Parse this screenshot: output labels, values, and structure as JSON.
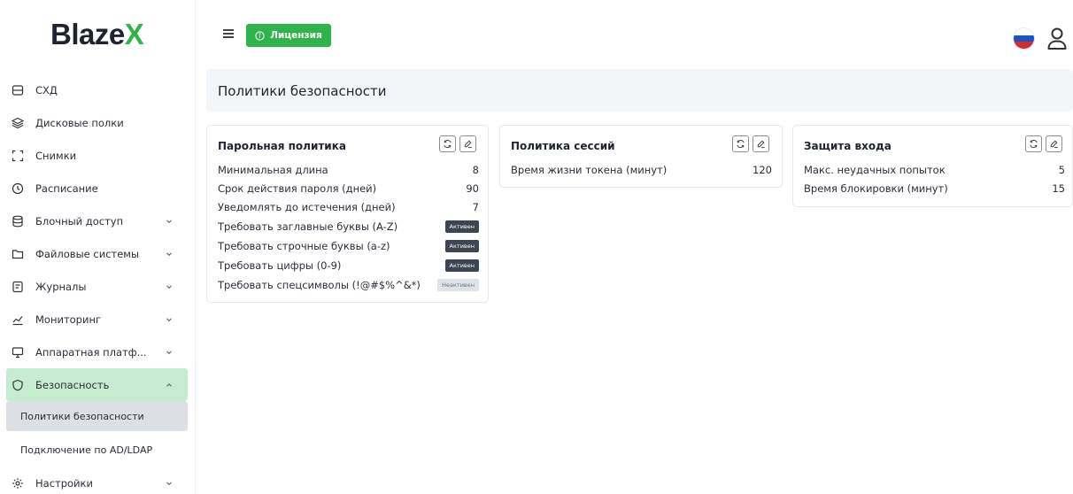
{
  "brand": {
    "name_main": "Blaze",
    "name_accent": "X"
  },
  "sidebar": {
    "items": [
      {
        "label": "СХД",
        "icon": "storage-icon"
      },
      {
        "label": "Дисковые полки",
        "icon": "layers-icon"
      },
      {
        "label": "Снимки",
        "icon": "snapshot-icon"
      },
      {
        "label": "Расписание",
        "icon": "clock-icon"
      },
      {
        "label": "Блочный доступ",
        "icon": "database-icon"
      },
      {
        "label": "Файловые системы",
        "icon": "folder-icon"
      },
      {
        "label": "Журналы",
        "icon": "log-icon"
      },
      {
        "label": "Мониторинг",
        "icon": "monitoring-icon"
      },
      {
        "label": "Аппаратная платф...",
        "icon": "hardware-icon"
      },
      {
        "label": "Безопасность",
        "icon": "shield-icon"
      },
      {
        "label": "Настройки",
        "icon": "gear-icon"
      }
    ],
    "security_sub": [
      {
        "label": "Политики безопасности"
      },
      {
        "label": "Подключение по AD/LDAP"
      }
    ]
  },
  "topbar": {
    "license_label": "Лицензия",
    "language": "ru-flag-icon"
  },
  "page": {
    "title": "Политики безопасности"
  },
  "cards": {
    "password": {
      "title": "Парольная политика",
      "rows": [
        {
          "label": "Минимальная длина",
          "value": "8"
        },
        {
          "label": "Срок действия пароля (дней)",
          "value": "90"
        },
        {
          "label": "Уведомлять до истечения (дней)",
          "value": "7"
        },
        {
          "label": "Требовать заглавные буквы (A-Z)",
          "value": "Активен"
        },
        {
          "label": "Требовать строчные буквы (a-z)",
          "value": "Активен"
        },
        {
          "label": "Требовать цифры (0-9)",
          "value": "Активен"
        },
        {
          "label": "Требовать спецсимволы (!@#$%^&*)",
          "value": "Неактивен"
        }
      ]
    },
    "session": {
      "title": "Политика сессий",
      "rows": [
        {
          "label": "Время жизни токена (минут)",
          "value": "120"
        }
      ]
    },
    "login": {
      "title": "Защита входа",
      "rows": [
        {
          "label": "Макс. неудачных попыток",
          "value": "5"
        },
        {
          "label": "Время блокировки (минут)",
          "value": "15"
        }
      ]
    }
  },
  "colors": {
    "accent": "#2fb34a",
    "active_bg": "#c6eccf",
    "badge_on": "#3d4452",
    "badge_off": "#dfe3e8"
  }
}
